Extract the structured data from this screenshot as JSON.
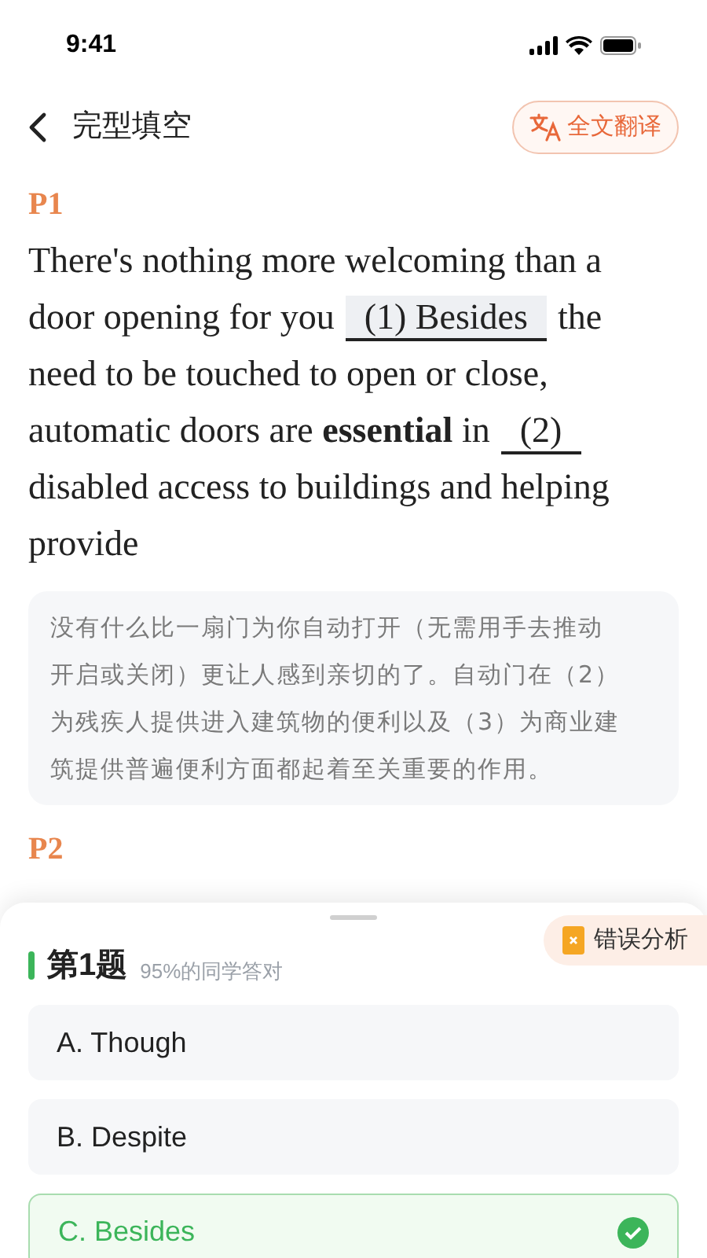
{
  "status_bar": {
    "time": "9:41"
  },
  "header": {
    "title": "完型填空",
    "translate_button": "全文翻译"
  },
  "passages": [
    {
      "label": "P1",
      "lines": [
        [
          {
            "kind": "text",
            "text": "There's nothing more welcoming than a"
          }
        ],
        [
          {
            "kind": "text",
            "text": "door opening for you"
          },
          {
            "kind": "blank",
            "text": "(1) Besides",
            "filled": true
          },
          {
            "kind": "text",
            "text": "the"
          }
        ],
        [
          {
            "kind": "text",
            "text": "need to be touched to open or close,"
          }
        ],
        [
          {
            "kind": "text",
            "text": "automatic doors are **essential** in"
          },
          {
            "kind": "blank",
            "text": "(2)",
            "filled": false
          }
        ],
        [
          {
            "kind": "text",
            "text": "disabled access to buildings and helping"
          }
        ],
        [
          {
            "kind": "text",
            "text": "provide"
          }
        ]
      ],
      "translation_lines": [
        "没有什么比一扇门为你自动打开（无需用手去推动",
        "开启或关闭）更让人感到亲切的了。自动门在（2）",
        "为残疾人提供进入建筑物的便利以及（3）为商业建",
        "筑提供普遍便利方面都起着至关重要的作用。"
      ]
    },
    {
      "label": "P2"
    }
  ],
  "question_sheet": {
    "error_analysis": "错误分析",
    "title": "第1题",
    "stats": "95%的同学答对",
    "options": [
      {
        "text": "A. Though",
        "selected": false
      },
      {
        "text": "B. Despite",
        "selected": false
      },
      {
        "text": "C. Besides",
        "selected": true
      }
    ]
  }
}
